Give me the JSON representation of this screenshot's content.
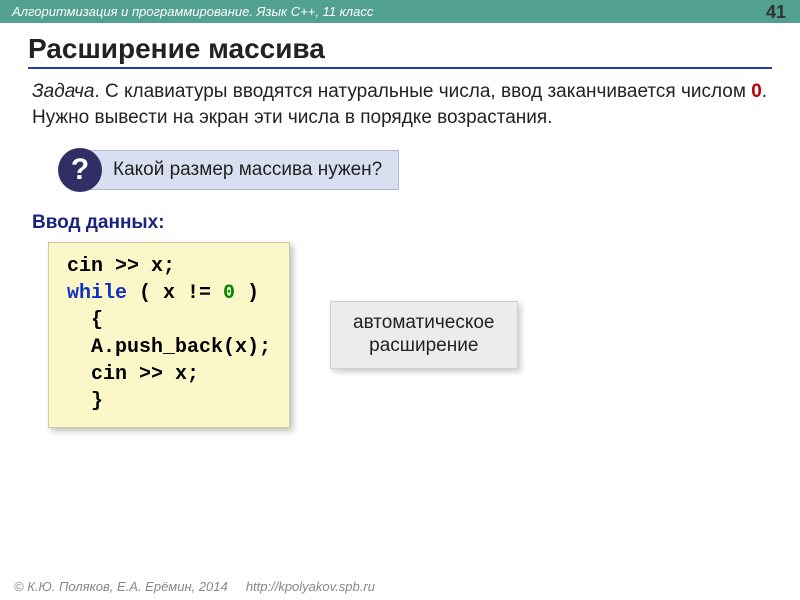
{
  "header": {
    "course": "Алгоритмизация и программирование. Язык C++, 11 класс",
    "page": "41"
  },
  "title": "Расширение массива",
  "task": {
    "label": "Задача",
    "part1": ". С клавиатуры вводятся натуральные числа, ввод заканчивается числом ",
    "zero": "0",
    "part2": ". Нужно вывести на экран эти числа в порядке возрастания."
  },
  "question": {
    "mark": "?",
    "text": "Какой размер массива нужен?"
  },
  "input_heading": "Ввод данных:",
  "code": {
    "l1a": "cin >> x;",
    "l2a": "while",
    "l2b": " ( x != ",
    "l2c": "0",
    "l2d": " )",
    "l3": "  {",
    "l4": "  A.push_back(x);",
    "l5": "  cin >> x;",
    "l6": "  }"
  },
  "note": {
    "line1": "автоматическое",
    "line2": "расширение"
  },
  "footer": {
    "copyright": "© К.Ю. Поляков, Е.А. Ерёмин, 2014",
    "url": "http://kpolyakov.spb.ru"
  }
}
